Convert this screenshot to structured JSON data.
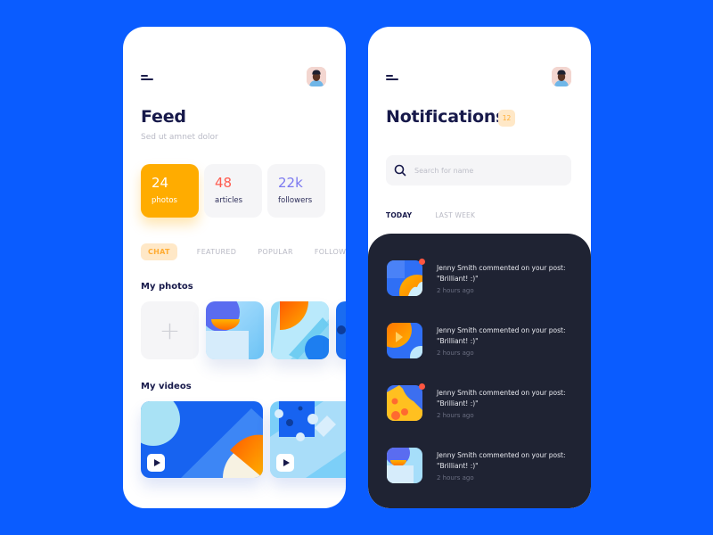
{
  "feed": {
    "title": "Feed",
    "subtitle": "Sed ut amnet dolor",
    "stats": [
      {
        "value": "24",
        "label": "photos",
        "color": "#ffffff",
        "active": true
      },
      {
        "value": "48",
        "label": "articles",
        "color": "#ff5a4e",
        "active": false
      },
      {
        "value": "22k",
        "label": "followers",
        "color": "#7b79f0",
        "active": false
      }
    ],
    "tabs": [
      "CHAT",
      "FEATURED",
      "POPULAR",
      "FOLLOWING"
    ],
    "active_tab": "CHAT",
    "photos_title": "My photos",
    "add_photo_symbol": "+",
    "videos_title": "My videos"
  },
  "notifications": {
    "title": "Notifications",
    "count": "12",
    "search_placeholder": "Search for name",
    "search_value": "",
    "tabs": [
      "TODAY",
      "LAST WEEK"
    ],
    "active_tab": "TODAY",
    "items": [
      {
        "text": "Jenny Smith commented on your post: \"Brilliant! :)\"",
        "time": "2 hours ago",
        "unread": true
      },
      {
        "text": "Jenny Smith commented on your post: \"Brilliant! :)\"",
        "time": "2 hours ago",
        "unread": false
      },
      {
        "text": "Jenny Smith commented on your post: \"Brilliant! :)\"",
        "time": "2 hours ago",
        "unread": true
      },
      {
        "text": "Jenny Smith commented on your post: \"Brilliant! :)\"",
        "time": "2 hours ago",
        "unread": false
      }
    ]
  },
  "colors": {
    "background": "#0a5cff",
    "accent": "#ffac00",
    "dark_panel": "#1f2333",
    "title": "#17194a",
    "unread_dot": "#ff5640"
  },
  "icons": {
    "menu": "menu-icon",
    "avatar": "user-avatar",
    "search": "search-icon",
    "play": "play-icon",
    "add": "plus-icon"
  }
}
